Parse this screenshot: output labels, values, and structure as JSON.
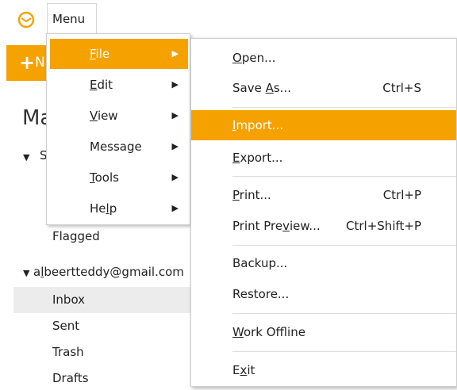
{
  "app": {
    "menu_button_label": "Menu",
    "new_button_text": "N",
    "main_heading": "Ma",
    "smart_folders_label": "S"
  },
  "menu": {
    "items": [
      {
        "label": "File",
        "underline": "F",
        "rest": "ile"
      },
      {
        "label": "Edit",
        "underline": "E",
        "rest": "dit"
      },
      {
        "label": "View",
        "underline": "V",
        "rest": "iew"
      },
      {
        "label": "Message",
        "underline": "",
        "rest": "Message"
      },
      {
        "label": "Tools",
        "underline": "T",
        "rest": "ools"
      },
      {
        "label": "Help",
        "pre": "He",
        "underline": "l",
        "rest": "p"
      }
    ]
  },
  "file_submenu": {
    "open": {
      "pre": "",
      "u": "O",
      "post": "pen..."
    },
    "save_as": {
      "pre": "Save ",
      "u": "A",
      "post": "s...",
      "shortcut": "Ctrl+S"
    },
    "import": {
      "pre": "",
      "u": "I",
      "post": "mport..."
    },
    "export": {
      "pre": "",
      "u": "E",
      "post": "xport..."
    },
    "print": {
      "pre": "",
      "u": "P",
      "post": "rint...",
      "shortcut": "Ctrl+P"
    },
    "print_preview": {
      "pre": "Print Pre",
      "u": "v",
      "post": "iew...",
      "shortcut": "Ctrl+Shift+P"
    },
    "backup": {
      "label": "Backup..."
    },
    "restore": {
      "label": "Restore..."
    },
    "work_offline": {
      "pre": "",
      "u": "W",
      "post": "ork Offline"
    },
    "exit": {
      "pre": "E",
      "u": "x",
      "post": "it"
    }
  },
  "sidebar": {
    "flagged": "Flagged",
    "account": {
      "pre": "a",
      "u": "l",
      "post": "beertteddy@gmail.com"
    },
    "folders": [
      "Inbox",
      "Sent",
      "Trash",
      "Drafts"
    ]
  },
  "colors": {
    "accent": "#f5a200"
  },
  "icons": {
    "logo": "envelope-at-icon",
    "submenu_arrow": "triangle-right-icon",
    "caret": "triangle-down-icon"
  }
}
